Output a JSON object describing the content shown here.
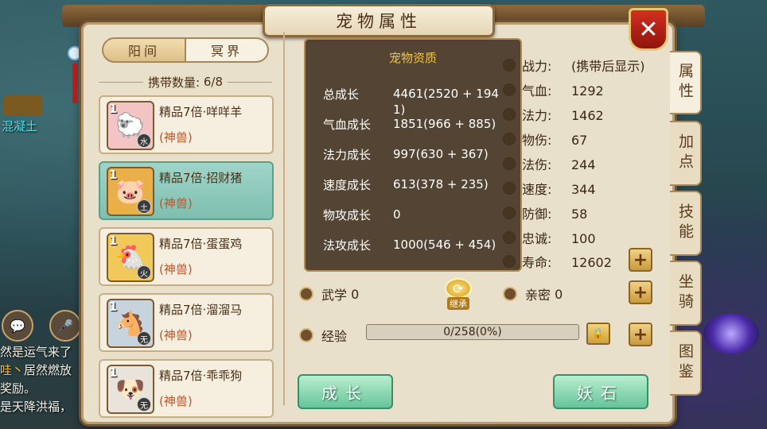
{
  "background": {
    "map_label": "混凝土",
    "chat_lines": [
      "然是运气来了",
      "哇丶居然燃放",
      "奖励。",
      "是天降洪福，"
    ],
    "chat_highlight": "哇丶"
  },
  "window": {
    "title": "宠物属性",
    "close_icon": "close-x-icon"
  },
  "realm_tabs": [
    {
      "label": "阳间",
      "active": true
    },
    {
      "label": "冥界",
      "active": false
    }
  ],
  "capacity": {
    "label": "携带数量:",
    "value": "6/8"
  },
  "pets": [
    {
      "level": "1",
      "name": "精品7倍·咩咩羊",
      "type": "(神兽)",
      "element": "水",
      "selected": false,
      "icon": "sheep-avatar",
      "color": "#f3c4c4"
    },
    {
      "level": "1",
      "name": "精品7倍·招财猪",
      "type": "(神兽)",
      "element": "土",
      "selected": true,
      "icon": "pig-avatar",
      "color": "#e9b04a"
    },
    {
      "level": "1",
      "name": "精品7倍·蛋蛋鸡",
      "type": "(神兽)",
      "element": "火",
      "selected": false,
      "icon": "chicken-avatar",
      "color": "#f1c95a"
    },
    {
      "level": "1",
      "name": "精品7倍·溜溜马",
      "type": "(神兽)",
      "element": "无",
      "selected": false,
      "icon": "horse-avatar",
      "color": "#c7d3dd"
    },
    {
      "level": "1",
      "name": "精品7倍·乖乖狗",
      "type": "(神兽)",
      "element": "无",
      "selected": false,
      "icon": "dog-avatar",
      "color": "#e8e4dc"
    }
  ],
  "attributes": [
    {
      "label": "战力:",
      "value": "(携带后显示)"
    },
    {
      "label": "气血:",
      "value": "1292"
    },
    {
      "label": "法力:",
      "value": "1462"
    },
    {
      "label": "物伤:",
      "value": "67"
    },
    {
      "label": "法伤:",
      "value": "244"
    },
    {
      "label": "速度:",
      "value": "344"
    },
    {
      "label": "防御:",
      "value": "58"
    },
    {
      "label": "忠诚:",
      "value": "100"
    },
    {
      "label": "寿命:",
      "value": "12602"
    }
  ],
  "martial": {
    "label": "武学",
    "value": "0"
  },
  "intimacy": {
    "label": "亲密",
    "value": "0"
  },
  "inherit_label": "继承",
  "experience": {
    "label": "经验",
    "text": "0/258(0%)",
    "percent": 0
  },
  "buttons": {
    "growth": "成长",
    "demon_stone": "妖石"
  },
  "side_tabs": [
    {
      "label": "属性",
      "active": true
    },
    {
      "label": "加点",
      "active": false
    },
    {
      "label": "技能",
      "active": false
    },
    {
      "label": "坐骑",
      "active": false
    },
    {
      "label": "图鉴",
      "active": false
    }
  ],
  "popup": {
    "title": "宠物资质",
    "rows": [
      {
        "label": "总成长",
        "value": "4461(2520 + 1941)"
      },
      {
        "label": "气血成长",
        "value": "1851(966 + 885)"
      },
      {
        "label": "法力成长",
        "value": "997(630 + 367)"
      },
      {
        "label": "速度成长",
        "value": "613(378 + 235)"
      },
      {
        "label": "物攻成长",
        "value": "0"
      },
      {
        "label": "法攻成长",
        "value": "1000(546 + 454)"
      }
    ]
  }
}
